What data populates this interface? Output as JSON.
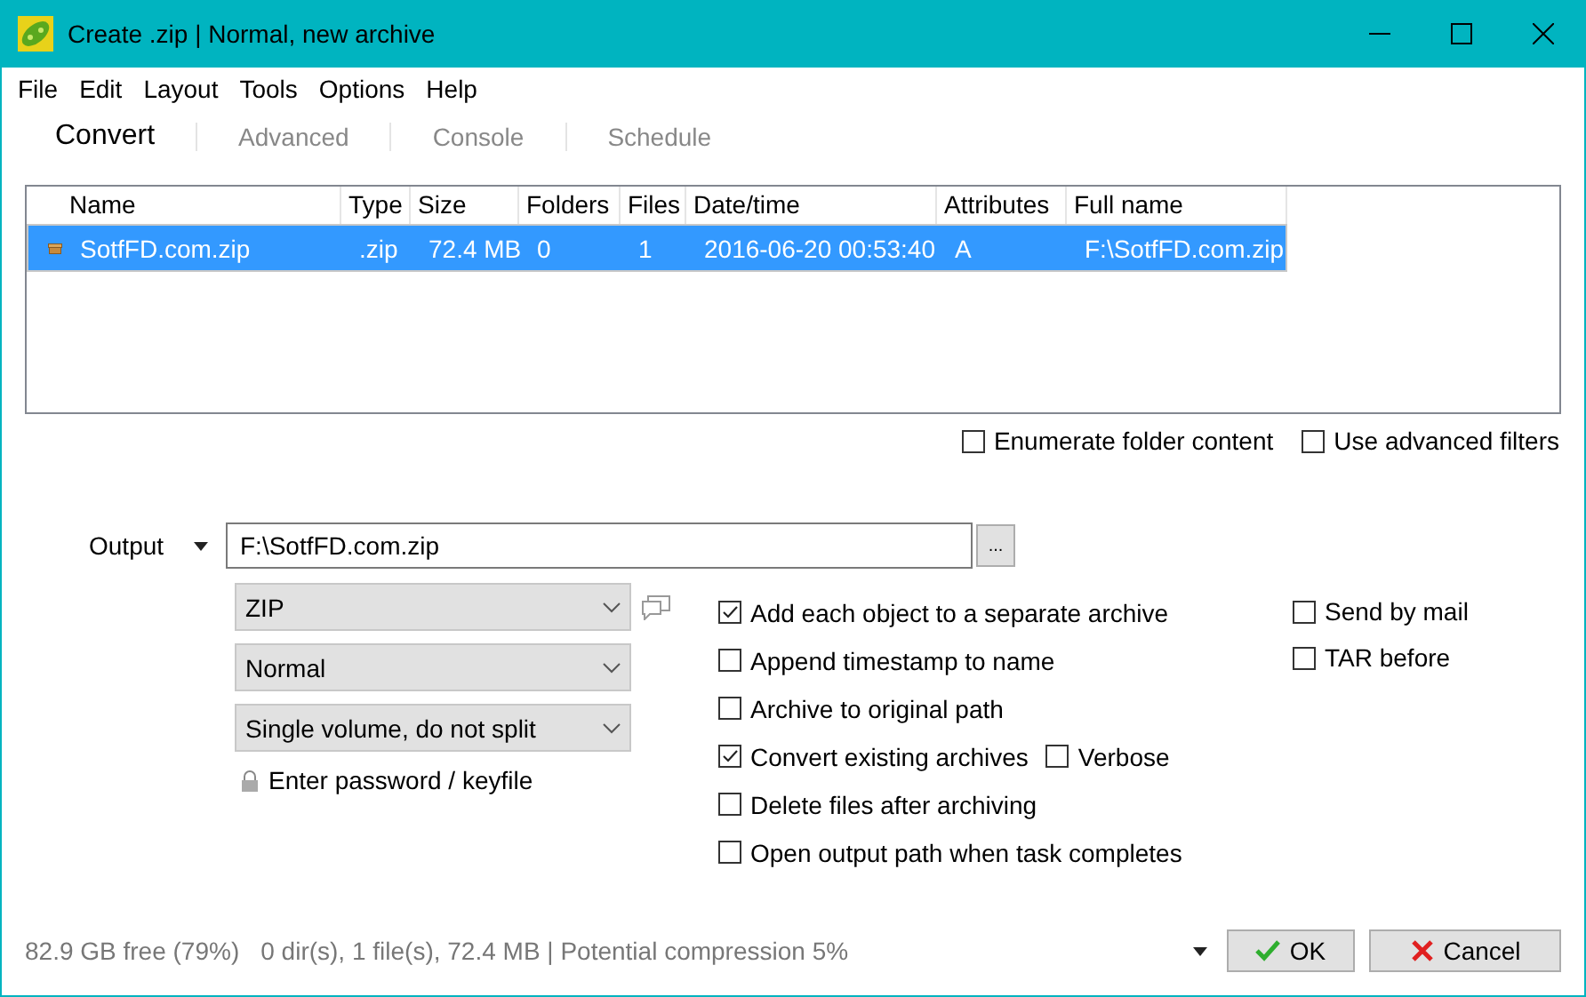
{
  "window": {
    "title": "Create .zip | Normal, new archive"
  },
  "menu": [
    "File",
    "Edit",
    "Layout",
    "Tools",
    "Options",
    "Help"
  ],
  "tabs": [
    {
      "label": "Convert",
      "selected": true
    },
    {
      "label": "Advanced",
      "selected": false
    },
    {
      "label": "Console",
      "selected": false
    },
    {
      "label": "Schedule",
      "selected": false
    }
  ],
  "table": {
    "columns": [
      "Name",
      "Type",
      "Size",
      "Folders",
      "Files",
      "Date/time",
      "Attributes",
      "Full name"
    ],
    "rows": [
      {
        "selected": true,
        "cells": [
          "SotfFD.com.zip",
          ".zip",
          "72.4 MB",
          "0",
          "1",
          "2016-06-20 00:53:40",
          "A",
          "F:\\SotfFD.com.zip"
        ]
      }
    ]
  },
  "list_options": [
    {
      "label": "Enumerate folder content",
      "checked": false
    },
    {
      "label": "Use advanced filters",
      "checked": false
    }
  ],
  "output": {
    "label": "Output",
    "value": "F:\\SotfFD.com.zip",
    "browse": "..."
  },
  "selects": [
    "ZIP",
    "Normal",
    "Single volume, do not split"
  ],
  "password_link": "Enter password / keyfile",
  "option_rows": [
    [
      {
        "label": "Add each object to a separate archive",
        "checked": true
      }
    ],
    [
      {
        "label": "Append timestamp to name",
        "checked": false
      }
    ],
    [
      {
        "label": "Archive to original path",
        "checked": false
      }
    ],
    [
      {
        "label": "Convert existing archives",
        "checked": true
      },
      {
        "label": "Verbose",
        "checked": false
      }
    ],
    [
      {
        "label": "Delete files after archiving",
        "checked": false
      }
    ],
    [
      {
        "label": "Open output path when task completes",
        "checked": false
      }
    ]
  ],
  "side_options": [
    {
      "label": "Send by mail",
      "checked": false
    },
    {
      "label": "TAR before",
      "checked": false
    }
  ],
  "status_bar": {
    "free": "82.9 GB free (79%)",
    "summary": "0 dir(s), 1 file(s), 72.4 MB | Potential compression 5%"
  },
  "buttons": {
    "ok": "OK",
    "cancel": "Cancel"
  }
}
